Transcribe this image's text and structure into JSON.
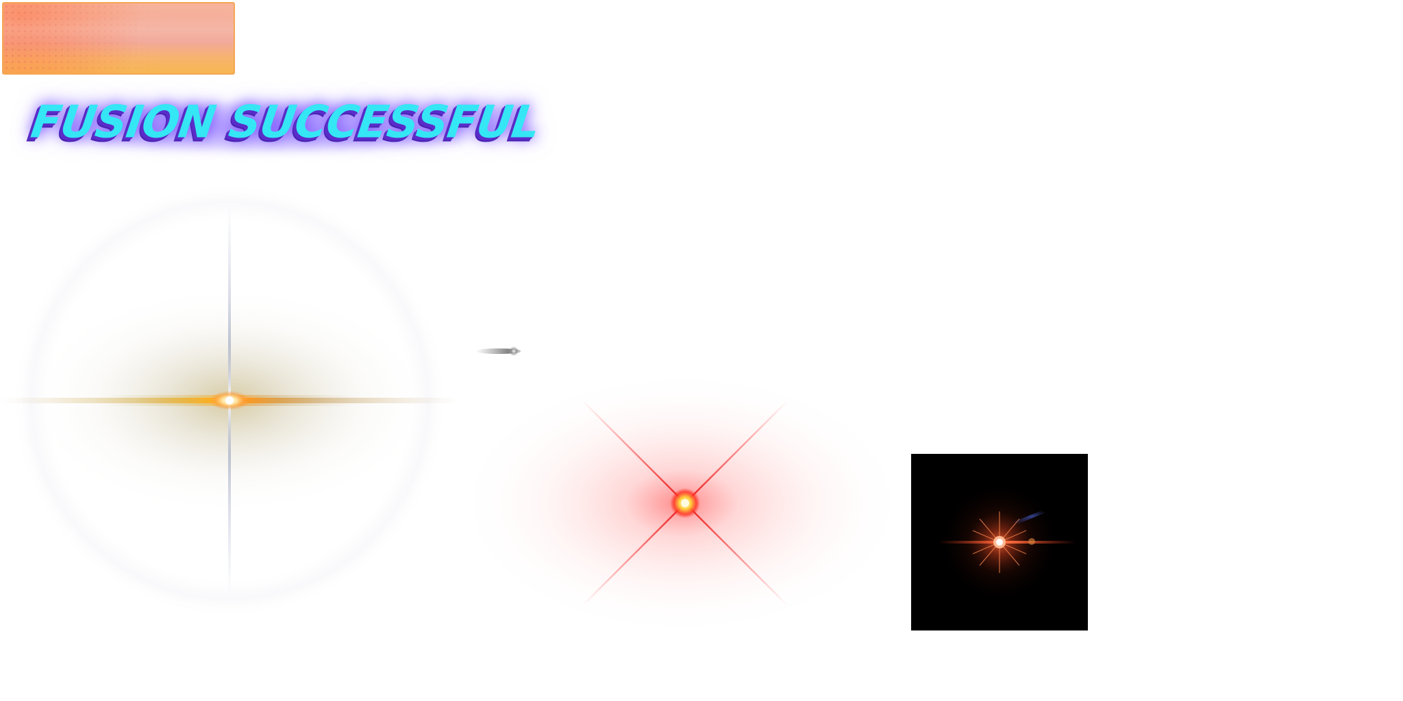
{
  "scene": {
    "title": "FUSION SUCCESSFUL",
    "colors": {
      "title_fill": "#35e6f4",
      "title_shadow": "#5a2cc9",
      "banner_top": "#f7b39b",
      "banner_bottom": "#f7b653",
      "banner_border": "#f4a653",
      "gold_flare": "#f5b22a",
      "red_flare": "#ff3a3a",
      "dark_flare_bg": "#000000",
      "dark_flare_core": "#ff6a3a"
    },
    "assets": [
      {
        "name": "orange-banner-panel"
      },
      {
        "name": "fusion-successful-title"
      },
      {
        "name": "gold-cross-lens-flare"
      },
      {
        "name": "grey-streak-flare"
      },
      {
        "name": "red-x-lens-flare"
      },
      {
        "name": "dark-orange-star-flare"
      }
    ]
  }
}
